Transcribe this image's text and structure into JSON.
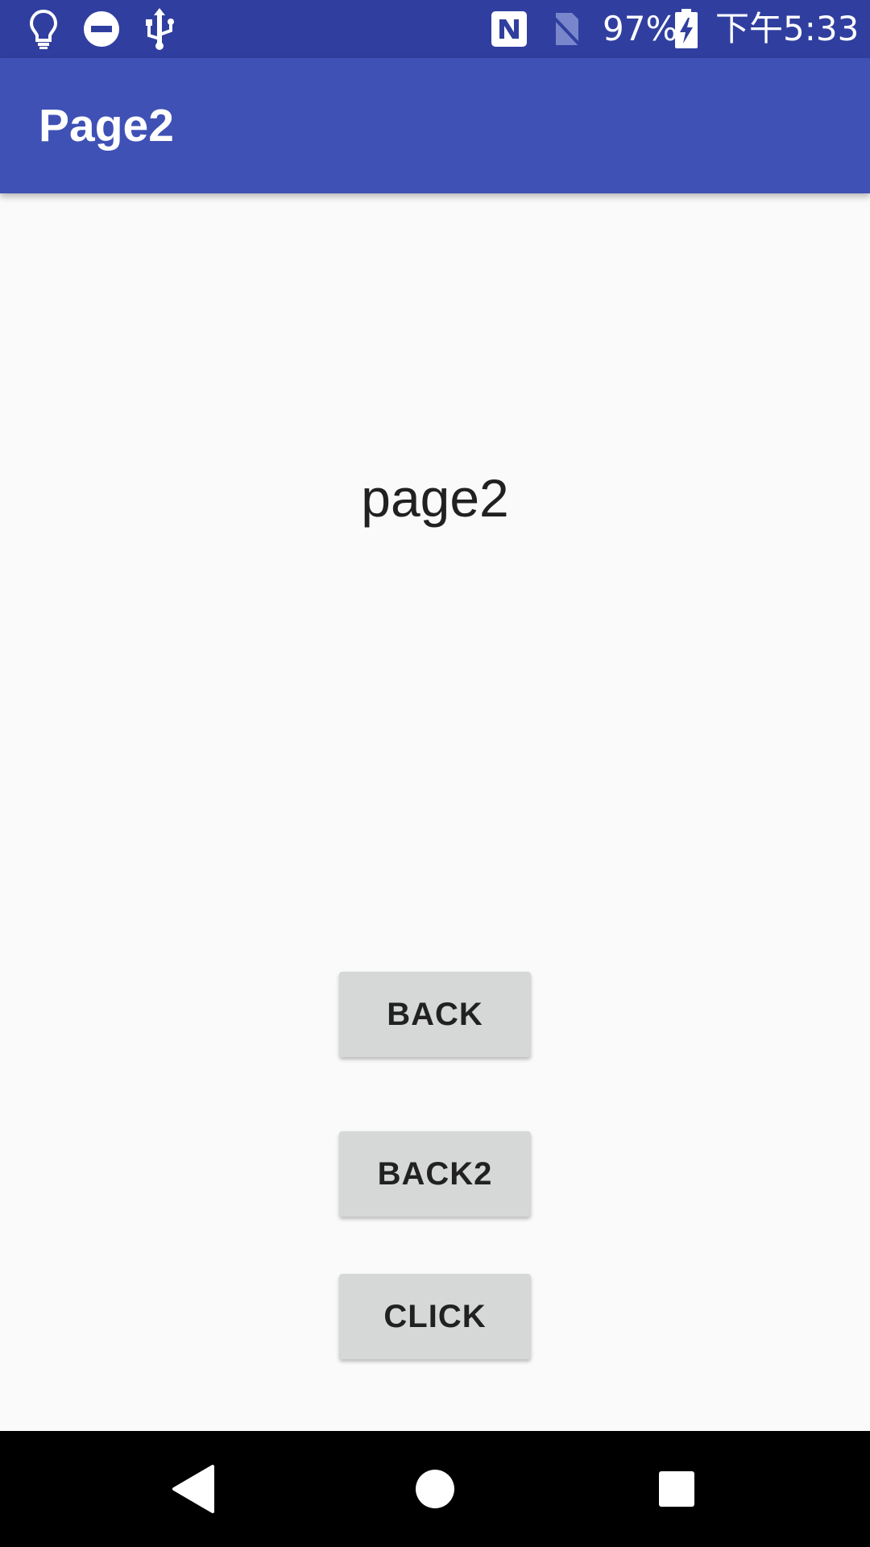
{
  "status_bar": {
    "battery_percent": "97%",
    "time": "下午5:33",
    "icons": [
      "lightbulb-icon",
      "do-not-disturb-icon",
      "usb-icon",
      "nfc-icon",
      "no-sim-icon",
      "battery-charging-icon"
    ]
  },
  "app_bar": {
    "title": "Page2"
  },
  "main": {
    "label": "page2",
    "buttons": {
      "back": "BACK",
      "back2": "BACK2",
      "click": "CLICK"
    }
  },
  "nav_bar": {
    "icons": [
      "back-triangle-icon",
      "home-circle-icon",
      "recents-square-icon"
    ]
  },
  "colors": {
    "status_bar": "#303F9F",
    "app_bar": "#3F51B5",
    "background": "#FAFAFA",
    "button": "#D6D7D7",
    "nav_bar": "#000000"
  }
}
